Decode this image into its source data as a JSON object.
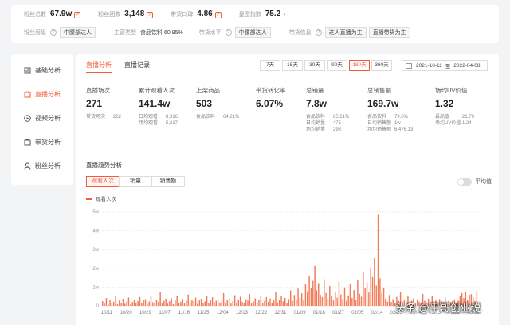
{
  "top": {
    "stats": [
      {
        "label": "粉丝总数",
        "value": "67.9w",
        "icon": "trend-icon"
      },
      {
        "label": "粉丝团数",
        "value": "3,148",
        "icon": "trend-icon"
      },
      {
        "label": "带货口碑",
        "value": "4.86",
        "icon": "trend-icon"
      },
      {
        "label": "星图指数",
        "value": "75.2",
        "icon": "chevron-right-icon"
      }
    ],
    "info": [
      {
        "label": "粉丝层级",
        "tags": [
          "中腰部达人"
        ]
      },
      {
        "label": "主营类型",
        "tags": [
          "食品饮料 60.95%"
        ]
      },
      {
        "label": "带货水平",
        "tags": [
          "中腰部达人"
        ]
      },
      {
        "label": "带货信息",
        "tags": [
          "达人直播为主",
          "直播带货为主"
        ]
      }
    ]
  },
  "sidebar": {
    "items": [
      {
        "label": "基础分析",
        "icon": "chart-icon",
        "active": false
      },
      {
        "label": "直播分析",
        "icon": "live-icon",
        "active": true
      },
      {
        "label": "视频分析",
        "icon": "play-icon",
        "active": false
      },
      {
        "label": "带货分析",
        "icon": "cart-icon",
        "active": false
      },
      {
        "label": "粉丝分析",
        "icon": "user-icon",
        "active": false
      }
    ]
  },
  "main": {
    "tabs": [
      {
        "label": "直播分析",
        "active": true
      },
      {
        "label": "直播记录",
        "active": false
      }
    ],
    "ranges": [
      {
        "label": "7天",
        "active": false
      },
      {
        "label": "15天",
        "active": false
      },
      {
        "label": "30天",
        "active": false
      },
      {
        "label": "90天",
        "active": false
      },
      {
        "label": "180天",
        "active": true
      },
      {
        "label": "360天",
        "active": false
      }
    ],
    "date_start": "2021-10-11",
    "date_sep": "至",
    "date_end": "2022-04-08",
    "metrics": [
      {
        "label": "直播场次",
        "value": "271",
        "subs": [
          [
            "带货场次",
            "262"
          ]
        ]
      },
      {
        "label": "累计观看人次",
        "value": "141.4w",
        "subs": [
          [
            "日均观看",
            "8,316"
          ],
          [
            "场均观看",
            "5,217"
          ]
        ]
      },
      {
        "label": "上架商品",
        "value": "503",
        "subs": [
          [
            "食品饮料",
            "64.21%"
          ]
        ]
      },
      {
        "label": "带货转化率",
        "value": "6.07%",
        "subs": []
      },
      {
        "label": "总销量",
        "value": "7.8w",
        "subs": [
          [
            "食品饮料",
            "85.21%"
          ],
          [
            "日均销量",
            "475"
          ],
          [
            "场均销量",
            "298"
          ]
        ]
      },
      {
        "label": "总销售额",
        "value": "169.7w",
        "subs": [
          [
            "食品饮料",
            "79.6%"
          ],
          [
            "日均销售额",
            "1w"
          ],
          [
            "场均销售额",
            "6,476.13"
          ]
        ]
      },
      {
        "label": "场均UV价值",
        "value": "1.32",
        "subs": [
          [
            "最高值",
            "21.79"
          ],
          [
            "场均UV价值",
            "1.24"
          ]
        ]
      }
    ],
    "chart_title": "直播趋势分析",
    "segments": [
      {
        "label": "观看人次",
        "active": true
      },
      {
        "label": "销量",
        "active": false
      },
      {
        "label": "销售额",
        "active": false
      }
    ],
    "toggle_label": "平均值",
    "legend_label": "观看人次"
  },
  "chart_data": {
    "type": "bar",
    "title": "直播趋势分析",
    "series": [
      {
        "name": "观看人次",
        "values": [
          2500,
          1200,
          4200,
          800,
          3100,
          1500,
          2200,
          5100,
          900,
          2800,
          1600,
          3800,
          1100,
          2400,
          4500,
          700,
          2000,
          3300,
          1800,
          2600,
          4800,
          1300,
          2900,
          3600,
          1000,
          2300,
          5600,
          1900,
          1400,
          3400,
          2100,
          7200,
          1700,
          2700,
          3900,
          1200,
          2500,
          4100,
          900,
          3000,
          5300,
          1600,
          2200,
          3700,
          1400,
          2800,
          6100,
          1800,
          3300,
          2500,
          4400,
          1100,
          2900,
          3800,
          1700,
          2400,
          5200,
          1300,
          3100,
          4600,
          2000,
          2700,
          3500,
          1500,
          2300,
          6800,
          1900,
          3000,
          4200,
          1200,
          2600,
          5700,
          1800,
          3400,
          4900,
          2200,
          1400,
          3600,
          2800,
          6300,
          1600,
          2500,
          4000,
          1900,
          3200,
          5500,
          1300,
          2700,
          4700,
          2100,
          3900,
          1500,
          2900,
          7400,
          1800,
          3300,
          5100,
          2400,
          4300,
          1700,
          3600,
          8200,
          2600,
          5800,
          3100,
          9200,
          4100,
          6700,
          3400,
          11400,
          7800,
          16100,
          9600,
          13300,
          21300,
          8300,
          12100,
          5900,
          4700,
          14200,
          6900,
          3800,
          10600,
          5300,
          2900,
          7700,
          4400,
          12800,
          6100,
          3500,
          9800,
          2700,
          5600,
          11700,
          4200,
          8400,
          3300,
          13600,
          6500,
          4900,
          18100,
          9300,
          12400,
          7100,
          20600,
          15300,
          25400,
          10800,
          48500,
          14700,
          6900,
          9500,
          3900,
          2300,
          5800,
          2100,
          3600,
          1400,
          4800,
          2600,
          7400,
          1900,
          3100,
          2500,
          5600,
          1500,
          2800,
          4100,
          1200,
          3400,
          2200,
          1800,
          6400,
          2700,
          1100,
          3900,
          2000,
          5200,
          1600,
          2900,
          1300,
          3700,
          2400,
          1900,
          4500,
          1500,
          3200,
          2100,
          2600,
          3500,
          1400,
          2800,
          5400,
          6800,
          4200,
          7600,
          3100,
          5900,
          6300,
          4700,
          2600,
          7900
        ]
      }
    ],
    "x_ticks": [
      "10/11",
      "10/20",
      "10/29",
      "11/07",
      "11/16",
      "11/25",
      "12/04",
      "12/13",
      "12/22",
      "12/31",
      "01/09",
      "01/18",
      "01/27",
      "02/05",
      "02/14",
      "02/23",
      "03/04",
      "03/13",
      "03/22",
      "03/31"
    ],
    "y_ticks": [
      "0",
      "1w",
      "2w",
      "3w",
      "4w",
      "5w"
    ],
    "ylim": [
      0,
      50000
    ],
    "grid": true,
    "legend": "top-left"
  },
  "colors": {
    "accent": "#f25c3b",
    "bar": "#f47a57"
  },
  "watermark": "头条 @平哥创业说"
}
